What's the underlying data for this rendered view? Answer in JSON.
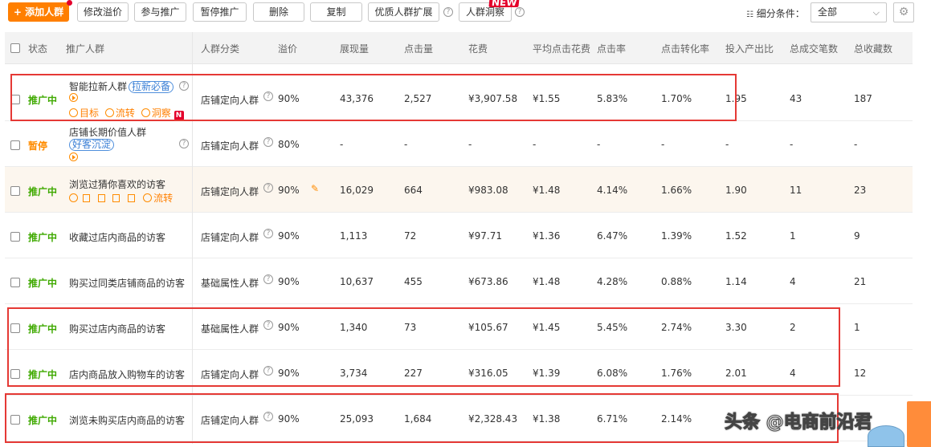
{
  "toolbar": {
    "add_label": "+ 添加人群",
    "buttons": [
      "修改溢价",
      "参与推广",
      "暂停推广",
      "删除",
      "复制",
      "优质人群扩展",
      "人群洞察"
    ],
    "new_badge": "NEW",
    "filter_label": "细分条件：",
    "filter_value": "全部"
  },
  "table": {
    "headers": [
      "状态",
      "推广人群",
      "人群分类",
      "溢价",
      "展现量",
      "点击量",
      "花费",
      "平均点击花费",
      "点击率",
      "点击转化率",
      "投入产出比",
      "总成交笔数",
      "总收藏数"
    ],
    "rows": [
      {
        "status": "推广中",
        "name": "智能拉新人群",
        "tag": "拉新必备",
        "ops": [
          "目标",
          "流转",
          "洞察"
        ],
        "n_badge": "N",
        "category": "店铺定向人群",
        "premium": "90%",
        "impressions": "43,376",
        "clicks": "2,527",
        "cost": "¥3,907.58",
        "cpc": "¥1.55",
        "ctr": "5.83%",
        "cvr": "1.70%",
        "roi": "1.95",
        "orders": "43",
        "favorites": "187"
      },
      {
        "status": "暂停",
        "name": "店铺长期价值人群",
        "tag": "好客沉淀",
        "category": "店铺定向人群",
        "premium": "80%",
        "impressions": "-",
        "clicks": "-",
        "cost": "-",
        "cpc": "-",
        "ctr": "-",
        "cvr": "-",
        "roi": "-",
        "orders": "-",
        "favorites": "-"
      },
      {
        "status": "推广中",
        "name": "浏览过猜你喜欢的访客",
        "ops": [
          "流转"
        ],
        "category": "店铺定向人群",
        "premium": "90%",
        "impressions": "16,029",
        "clicks": "664",
        "cost": "¥983.08",
        "cpc": "¥1.48",
        "ctr": "4.14%",
        "cvr": "1.66%",
        "roi": "1.90",
        "orders": "11",
        "favorites": "23"
      },
      {
        "status": "推广中",
        "name": "收藏过店内商品的访客",
        "category": "店铺定向人群",
        "premium": "90%",
        "impressions": "1,113",
        "clicks": "72",
        "cost": "¥97.71",
        "cpc": "¥1.36",
        "ctr": "6.47%",
        "cvr": "1.39%",
        "roi": "1.52",
        "orders": "1",
        "favorites": "9"
      },
      {
        "status": "推广中",
        "name": "购买过同类店铺商品的访客",
        "category": "基础属性人群",
        "premium": "90%",
        "impressions": "10,637",
        "clicks": "455",
        "cost": "¥673.86",
        "cpc": "¥1.48",
        "ctr": "4.28%",
        "cvr": "0.88%",
        "roi": "1.14",
        "orders": "4",
        "favorites": "21"
      },
      {
        "status": "推广中",
        "name": "购买过店内商品的访客",
        "category": "基础属性人群",
        "premium": "90%",
        "impressions": "1,340",
        "clicks": "73",
        "cost": "¥105.67",
        "cpc": "¥1.45",
        "ctr": "5.45%",
        "cvr": "2.74%",
        "roi": "3.30",
        "orders": "2",
        "favorites": "1"
      },
      {
        "status": "推广中",
        "name": "店内商品放入购物车的访客",
        "category": "店铺定向人群",
        "premium": "90%",
        "impressions": "3,734",
        "clicks": "227",
        "cost": "¥316.05",
        "cpc": "¥1.39",
        "ctr": "6.08%",
        "cvr": "1.76%",
        "roi": "2.01",
        "orders": "4",
        "favorites": "12"
      },
      {
        "status": "推广中",
        "name": "浏览未购买店内商品的访客",
        "category": "店铺定向人群",
        "premium": "90%",
        "impressions": "25,093",
        "clicks": "1,684",
        "cost": "¥2,328.43",
        "cpc": "¥1.38",
        "ctr": "6.71%",
        "cvr": "2.14%",
        "roi": "",
        "orders": "",
        "favorites": ""
      }
    ]
  },
  "watermark": "头条 @电商前沿君",
  "colors": {
    "accent": "#ff7f00",
    "active": "#3fa900",
    "paused": "#ff8c00",
    "annotation": "#e53935",
    "tag": "#3a7fd5"
  }
}
